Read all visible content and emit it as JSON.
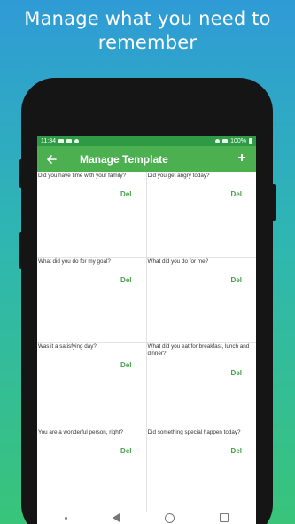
{
  "headline": "Manage what you need to remember",
  "status_bar": {
    "time": "11:34",
    "battery": "100%",
    "icons": [
      "image-icon",
      "message-icon",
      "wifi-icon",
      "signal-icon",
      "battery-icon"
    ]
  },
  "app_bar": {
    "title": "Manage Template",
    "back_icon": "arrow-left-icon",
    "add_icon": "plus-icon",
    "add_label": "+",
    "color": "#4caf50"
  },
  "templates": [
    {
      "question": "Did you have time with your family?",
      "delete_label": "Del"
    },
    {
      "question": "Did you get angry today?",
      "delete_label": "Del"
    },
    {
      "question": "What did you do for my goal?",
      "delete_label": "Del"
    },
    {
      "question": "What did you do for me?",
      "delete_label": "Del"
    },
    {
      "question": "Was it a satisfying day?",
      "delete_label": "Del"
    },
    {
      "question": "What did you eat for breakfast, lunch and dinner?",
      "delete_label": "Del"
    },
    {
      "question": "You are a wonderful person, right?",
      "delete_label": "Del"
    },
    {
      "question": "Did something special happen today?",
      "delete_label": "Del"
    }
  ],
  "nav_bar": {
    "icons": [
      "menu-dot-icon",
      "back-triangle-icon",
      "home-circle-icon",
      "recents-square-icon"
    ]
  },
  "colors": {
    "accent": "#4caf50",
    "status_bar": "#2e9a45",
    "delete_text": "#43a047",
    "background_top": "#2f9bd6",
    "background_bottom": "#39c47a"
  }
}
